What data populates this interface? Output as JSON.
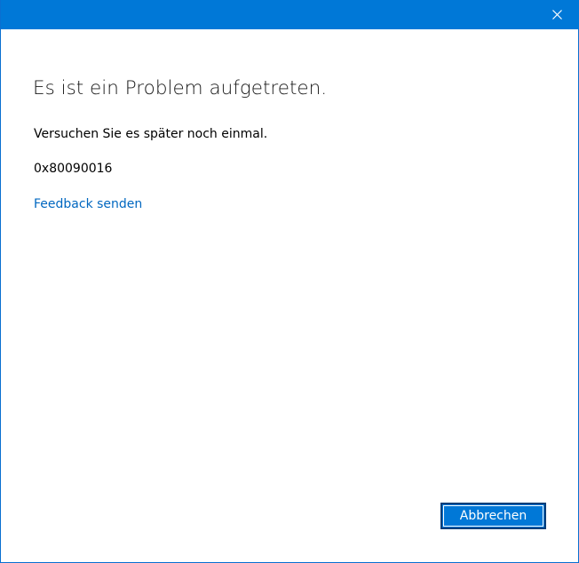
{
  "window": {
    "accent_color": "#0078d7",
    "close_icon": "close-icon"
  },
  "dialog": {
    "title": "Es ist ein Problem aufgetreten.",
    "message": "Versuchen Sie es später noch einmal.",
    "error_code": "0x80090016",
    "feedback_link": "Feedback senden",
    "cancel_label": "Abbrechen"
  },
  "colors": {
    "link": "#0067c0",
    "button": "#0078d7",
    "text": "#000000"
  }
}
